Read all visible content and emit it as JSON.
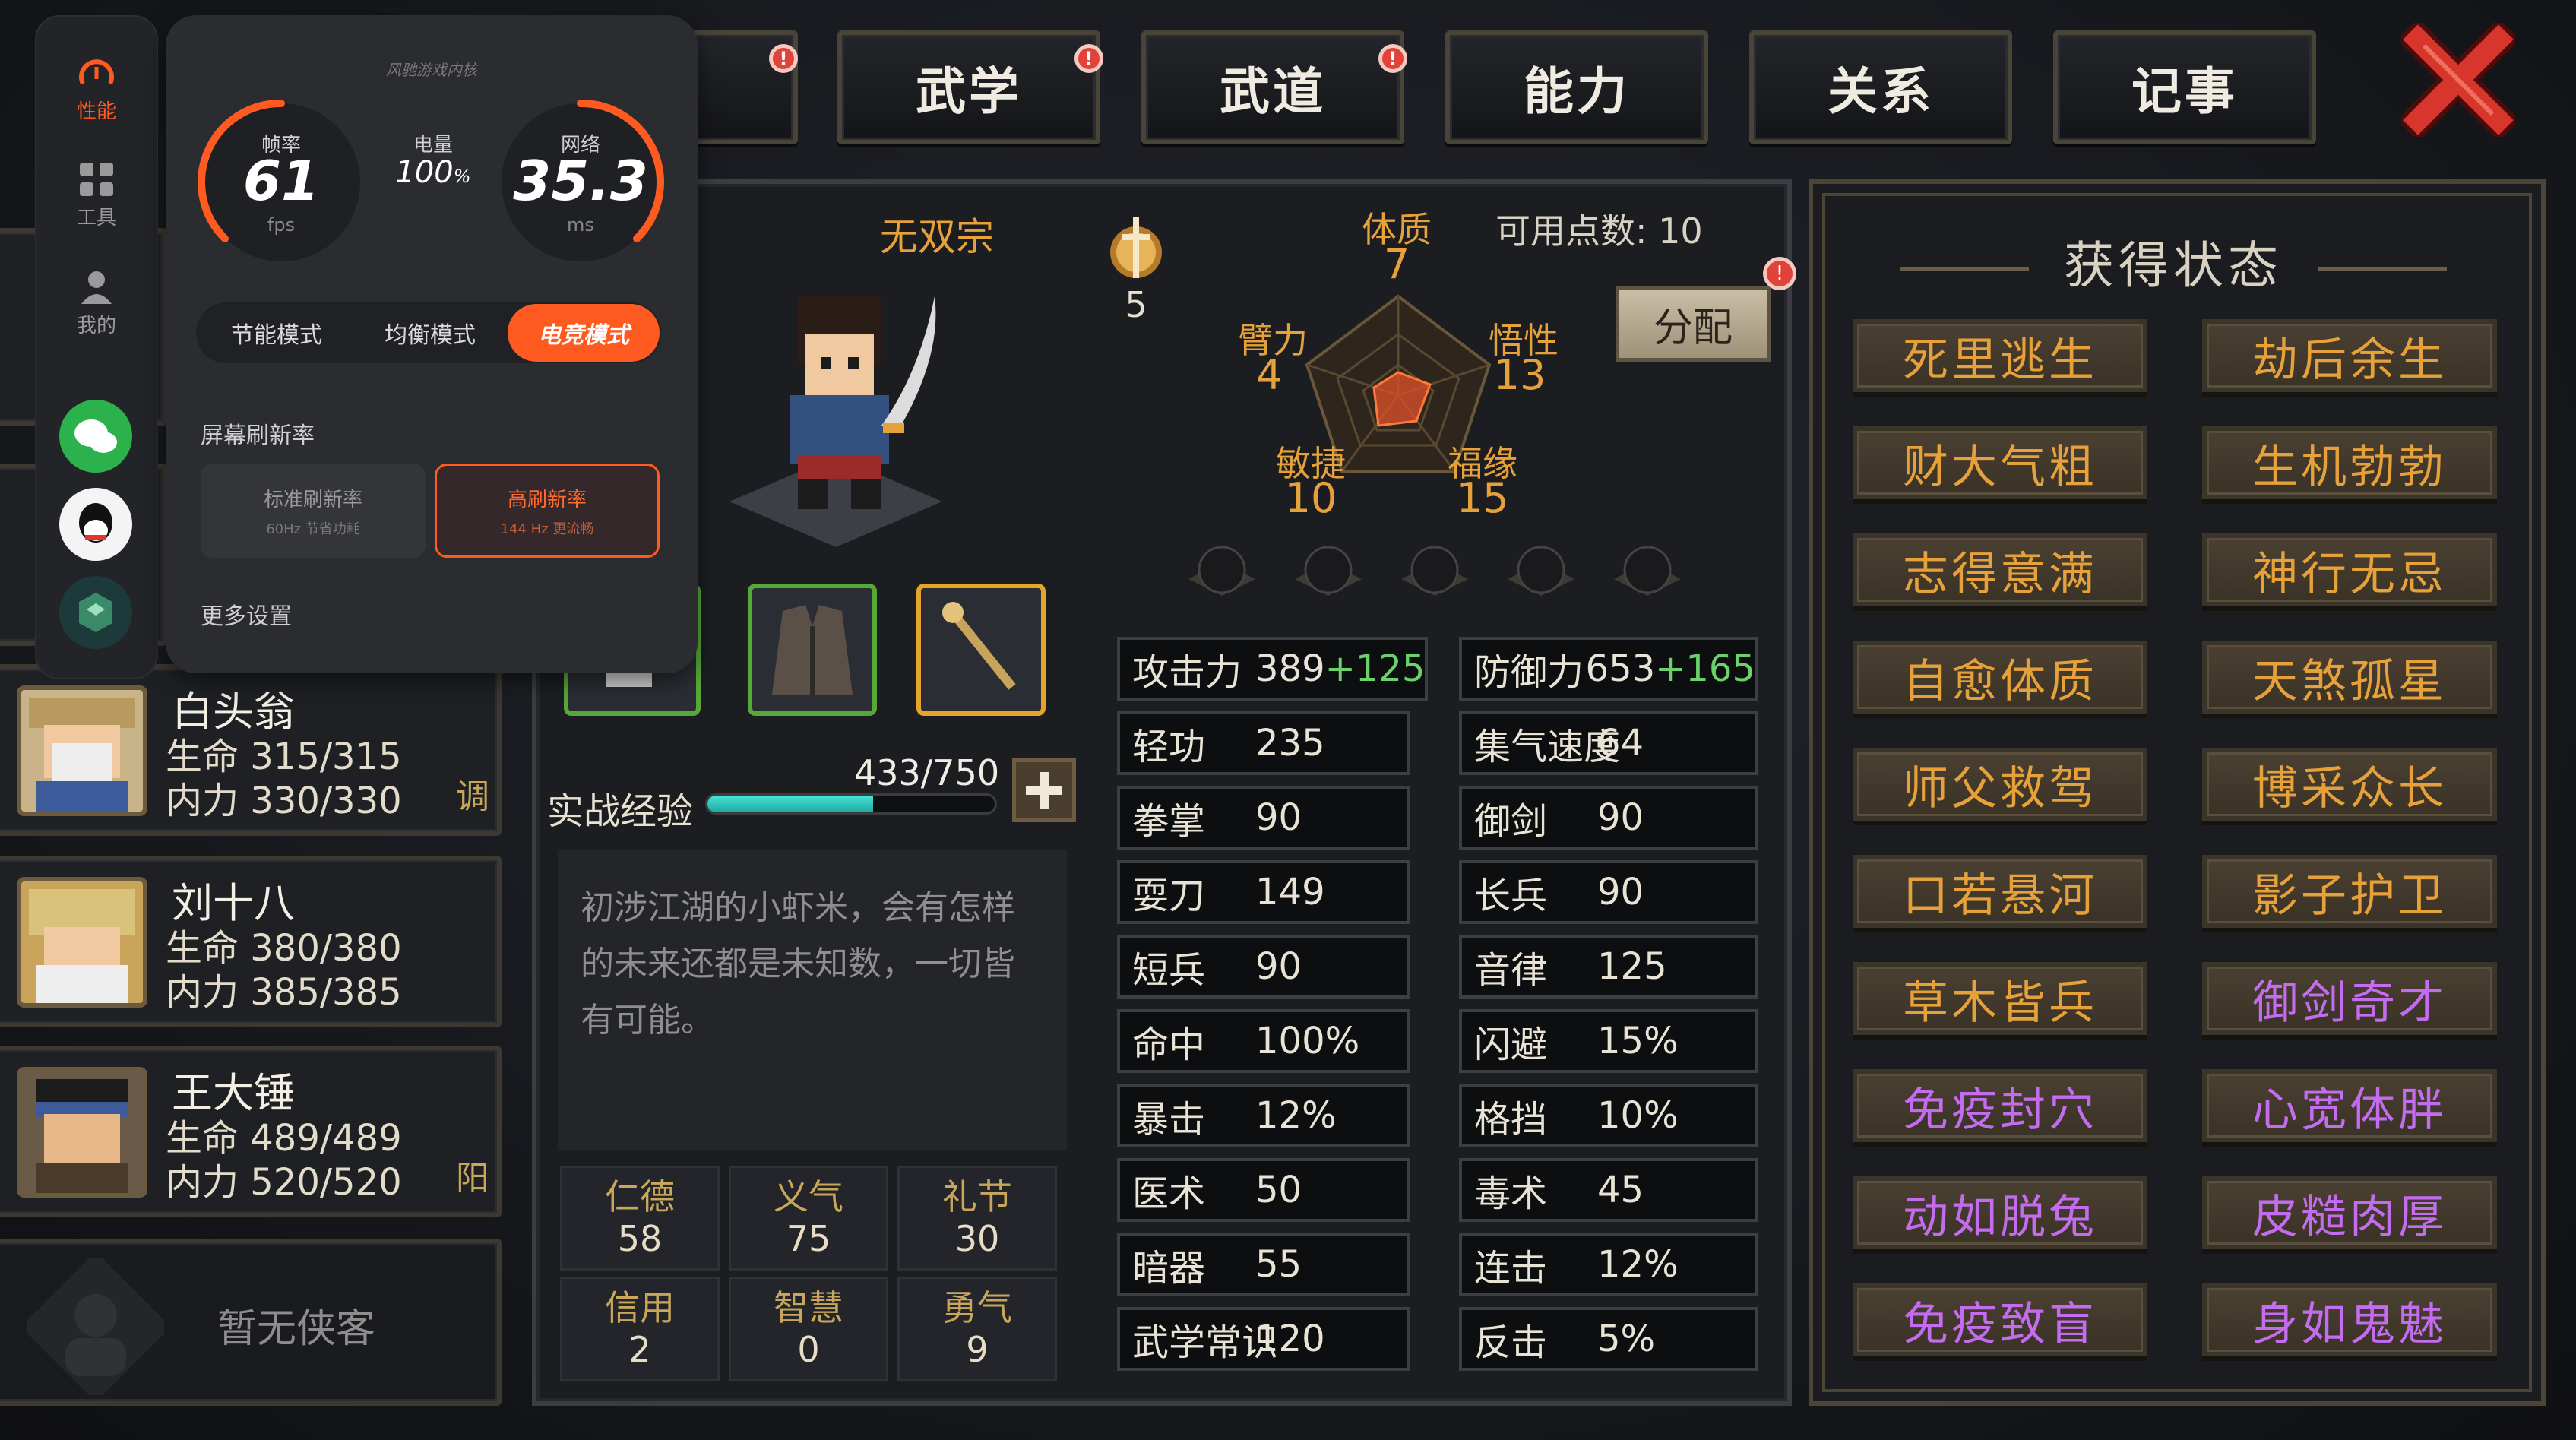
{
  "tabs": [
    {
      "label": "",
      "badge": "!"
    },
    {
      "label": "武学",
      "badge": "!"
    },
    {
      "label": "武道",
      "badge": "!"
    },
    {
      "label": "能力",
      "badge": ""
    },
    {
      "label": "关系",
      "badge": ""
    },
    {
      "label": "记事",
      "badge": ""
    }
  ],
  "roster": [
    {
      "name": "白头翁",
      "hp": "生命 315/315",
      "mp": "内力 330/330",
      "tag": "调"
    },
    {
      "name": "刘十八",
      "hp": "生命 380/380",
      "mp": "内力 385/385",
      "tag": ""
    },
    {
      "name": "王大锤",
      "hp": "生命 489/489",
      "mp": "内力 520/520",
      "tag": "阳"
    }
  ],
  "roster_empty": "暂无侠客",
  "character": {
    "sect": "无双宗",
    "rank_level": "5",
    "exp_label": "实战经验",
    "exp_text": "433/750",
    "exp_progress": 0.577,
    "description": "初涉江湖的小虾米，会有怎样的未来还都是未知数，一切皆有可能。"
  },
  "attributes": {
    "points_label": "可用点数: 10",
    "distribute_label": "分配",
    "tizhi": {
      "label": "体质",
      "value": "7"
    },
    "bili": {
      "label": "臂力",
      "value": "4"
    },
    "wuxing": {
      "label": "悟性",
      "value": "13"
    },
    "minjie": {
      "label": "敏捷",
      "value": "10"
    },
    "fuyuan": {
      "label": "福缘",
      "value": "15"
    }
  },
  "stats_left": [
    {
      "label": "攻击力",
      "value": "389",
      "bonus": "+125"
    },
    {
      "label": "轻功",
      "value": "235",
      "bonus": ""
    },
    {
      "label": "拳掌",
      "value": "90",
      "bonus": ""
    },
    {
      "label": "耍刀",
      "value": "149",
      "bonus": ""
    },
    {
      "label": "短兵",
      "value": "90",
      "bonus": ""
    },
    {
      "label": "命中",
      "value": "100%",
      "bonus": ""
    },
    {
      "label": "暴击",
      "value": "12%",
      "bonus": ""
    },
    {
      "label": "医术",
      "value": "50",
      "bonus": ""
    },
    {
      "label": "暗器",
      "value": "55",
      "bonus": ""
    },
    {
      "label": "武学常识",
      "value": "120",
      "bonus": ""
    }
  ],
  "stats_right": [
    {
      "label": "防御力",
      "value": "653",
      "bonus": "+165"
    },
    {
      "label": "集气速度",
      "value": "64",
      "bonus": ""
    },
    {
      "label": "御剑",
      "value": "90",
      "bonus": ""
    },
    {
      "label": "长兵",
      "value": "90",
      "bonus": ""
    },
    {
      "label": "音律",
      "value": "125",
      "bonus": ""
    },
    {
      "label": "闪避",
      "value": "15%",
      "bonus": ""
    },
    {
      "label": "格挡",
      "value": "10%",
      "bonus": ""
    },
    {
      "label": "毒术",
      "value": "45",
      "bonus": ""
    },
    {
      "label": "连击",
      "value": "12%",
      "bonus": ""
    },
    {
      "label": "反击",
      "value": "5%",
      "bonus": ""
    }
  ],
  "virtues": [
    {
      "label": "仁德",
      "value": "58"
    },
    {
      "label": "义气",
      "value": "75"
    },
    {
      "label": "礼节",
      "value": "30"
    },
    {
      "label": "信用",
      "value": "2"
    },
    {
      "label": "智慧",
      "value": "0"
    },
    {
      "label": "勇气",
      "value": "9"
    }
  ],
  "status_panel": {
    "title": "获得状态",
    "items": [
      {
        "label": "死里逃生",
        "color": "#e6a13a"
      },
      {
        "label": "劫后余生",
        "color": "#e6a13a"
      },
      {
        "label": "财大气粗",
        "color": "#e6a13a"
      },
      {
        "label": "生机勃勃",
        "color": "#e6a13a"
      },
      {
        "label": "志得意满",
        "color": "#e6a13a"
      },
      {
        "label": "神行无忌",
        "color": "#e6a13a"
      },
      {
        "label": "自愈体质",
        "color": "#e6a13a"
      },
      {
        "label": "天煞孤星",
        "color": "#e6a13a"
      },
      {
        "label": "师父救驾",
        "color": "#e6a13a"
      },
      {
        "label": "博采众长",
        "color": "#e6a13a"
      },
      {
        "label": "口若悬河",
        "color": "#e6a13a"
      },
      {
        "label": "影子护卫",
        "color": "#e6a13a"
      },
      {
        "label": "草木皆兵",
        "color": "#e6a13a"
      },
      {
        "label": "御剑奇才",
        "color": "#c46cf0"
      },
      {
        "label": "免疫封穴",
        "color": "#c46cf0"
      },
      {
        "label": "心宽体胖",
        "color": "#c46cf0"
      },
      {
        "label": "动如脱兔",
        "color": "#c46cf0"
      },
      {
        "label": "皮糙肉厚",
        "color": "#c46cf0"
      },
      {
        "label": "免疫致盲",
        "color": "#c46cf0"
      },
      {
        "label": "身如鬼魅",
        "color": "#c46cf0"
      }
    ]
  },
  "perf_overlay": {
    "sidebar": [
      {
        "label": "性能",
        "icon": "speedometer-icon"
      },
      {
        "label": "工具",
        "icon": "grid-icon"
      },
      {
        "label": "我的",
        "icon": "user-icon"
      }
    ],
    "header": "风驰游戏内核",
    "fps_label": "帧率",
    "fps_value": "61",
    "fps_unit": "fps",
    "battery_label": "电量",
    "battery_value": "100",
    "battery_unit": "%",
    "network_label": "网络",
    "network_value": "35.3",
    "network_unit": "ms",
    "modes": [
      "节能模式",
      "均衡模式",
      "电竞模式"
    ],
    "active_mode": "电竞模式",
    "refresh_label": "屏幕刷新率",
    "refresh_std_title": "标准刷新率",
    "refresh_std_sub": "60Hz 节省功耗",
    "refresh_high_title": "高刷新率",
    "refresh_high_sub": "144 Hz 更流畅",
    "more_label": "更多设置"
  },
  "colors": {
    "accent": "#ff5a1f",
    "gold": "#e6a13a",
    "purple": "#c46cf0",
    "green": "#6bd16b"
  }
}
